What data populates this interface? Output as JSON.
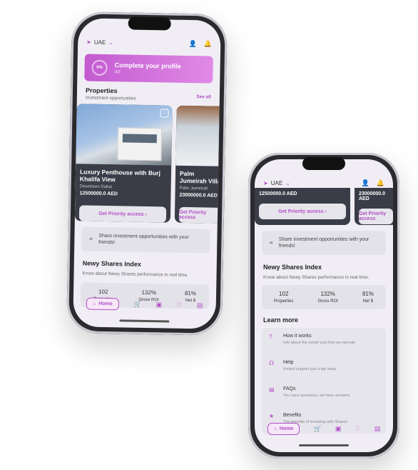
{
  "app": {
    "country": "UAE"
  },
  "profile": {
    "percent": "0%",
    "title": "Complete your profile",
    "steps": "0/3"
  },
  "properties": {
    "title": "Properties",
    "subtitle": "Investment opportunities",
    "see_all": "See all",
    "items": [
      {
        "name": "Luxury Penthouse with Burj Khalifa View",
        "location": "Downtown Dubai",
        "price": "12500000.0 AED",
        "cta": "Get Priority access"
      },
      {
        "name": "Palm Jumeirah Villa",
        "location": "Palm Jumeirah",
        "price": "23000000.0 AED",
        "cta": "Get Priority access"
      }
    ]
  },
  "share": {
    "text": "Share investment opportunities with your friends!"
  },
  "index": {
    "title": "Newy Shares Index",
    "subtitle": "Know about Newy Shares performance in real time.",
    "stats": [
      {
        "value": "102",
        "label": "Properties"
      },
      {
        "value": "132%",
        "label": "Gross ROI"
      },
      {
        "value": "81%",
        "label": "Net $"
      }
    ]
  },
  "learn": {
    "title": "Learn more",
    "items": [
      {
        "icon": "question-icon",
        "title": "How it works",
        "subtitle": "Info about the model and how we operate"
      },
      {
        "icon": "headset-icon",
        "title": "Help",
        "subtitle": "Instant support just a tap away"
      },
      {
        "icon": "chat-icon",
        "title": "FAQs",
        "subtitle": "You have questions, we have answers"
      },
      {
        "icon": "star-icon",
        "title": "Benefits",
        "subtitle": "The benefits of investing with Shares"
      }
    ]
  },
  "tabbar": {
    "home": "Home"
  }
}
